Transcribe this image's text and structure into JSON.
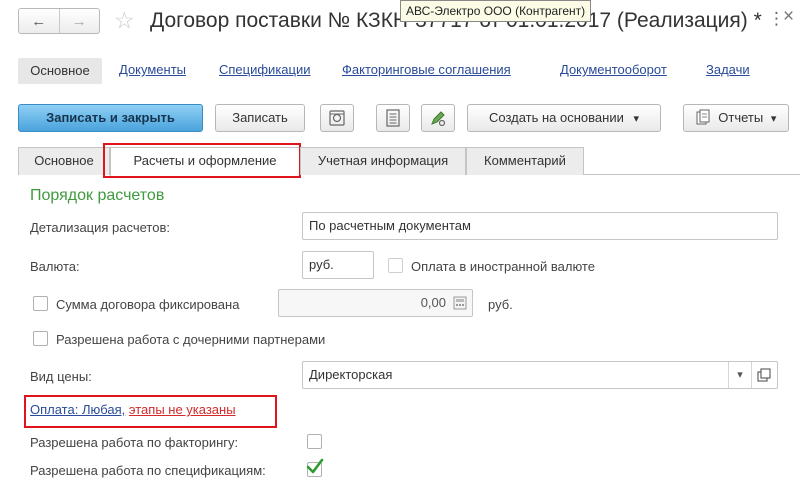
{
  "window": {
    "title": "Договор поставки № КЗКН-37717 от 01.01.2017 (Реализация) *",
    "tooltip": "АВС-Электро ООО (Контрагент)",
    "more_icon": "⋮",
    "close_icon": "×"
  },
  "nav": {
    "back": "←",
    "forward": "→",
    "star": "☆"
  },
  "sections": [
    {
      "label": "Основное"
    },
    {
      "label": "Документы"
    },
    {
      "label": "Спецификации"
    },
    {
      "label": "Факторинговые соглашения"
    },
    {
      "label": "Документооборот"
    },
    {
      "label": "Задачи"
    }
  ],
  "toolbar": {
    "save_close": "Записать и закрыть",
    "save": "Записать",
    "create_based": "Создать на основании",
    "reports": "Отчеты",
    "dropdown_caret": "▾"
  },
  "tabs": [
    {
      "label": "Основное"
    },
    {
      "label": "Расчеты и оформление"
    },
    {
      "label": "Учетная информация"
    },
    {
      "label": "Комментарий"
    }
  ],
  "form": {
    "group_title": "Порядок расчетов",
    "settlement_detail": {
      "label": "Детализация расчетов:",
      "value": "По расчетным документам"
    },
    "currency": {
      "label": "Валюта:",
      "value": "руб.",
      "foreign_label": "Оплата в иностранной валюте",
      "foreign_checked": false
    },
    "fixed_sum": {
      "label": "Сумма договора фиксирована",
      "checked": false,
      "value": "0,00",
      "unit": "руб."
    },
    "subsidiary": {
      "label": "Разрешена работа с дочерними партнерами",
      "checked": false
    },
    "price_type": {
      "label": "Вид цены:",
      "value": "Директорская"
    },
    "payment": {
      "link_blue": "Оплата: Любая,",
      "link_red": "этапы не указаны"
    },
    "factoring": {
      "label": "Разрешена работа по факторингу:",
      "checked": false
    },
    "specifications": {
      "label": "Разрешена работа по спецификациям:",
      "checked": true
    }
  }
}
